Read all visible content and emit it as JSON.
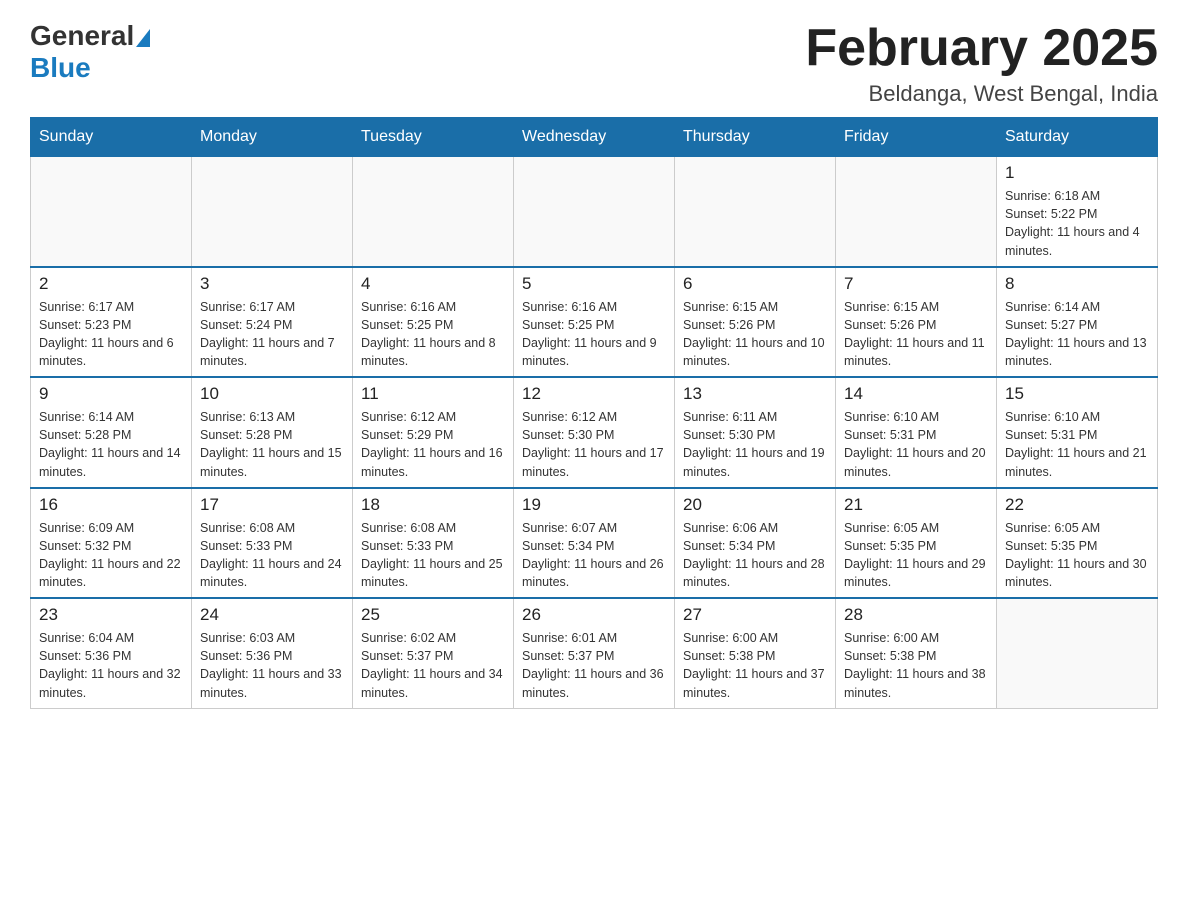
{
  "header": {
    "logo": {
      "general": "General",
      "blue": "Blue"
    },
    "title": "February 2025",
    "subtitle": "Beldanga, West Bengal, India"
  },
  "days_of_week": [
    "Sunday",
    "Monday",
    "Tuesday",
    "Wednesday",
    "Thursday",
    "Friday",
    "Saturday"
  ],
  "weeks": [
    [
      {
        "day": "",
        "info": ""
      },
      {
        "day": "",
        "info": ""
      },
      {
        "day": "",
        "info": ""
      },
      {
        "day": "",
        "info": ""
      },
      {
        "day": "",
        "info": ""
      },
      {
        "day": "",
        "info": ""
      },
      {
        "day": "1",
        "info": "Sunrise: 6:18 AM\nSunset: 5:22 PM\nDaylight: 11 hours and 4 minutes."
      }
    ],
    [
      {
        "day": "2",
        "info": "Sunrise: 6:17 AM\nSunset: 5:23 PM\nDaylight: 11 hours and 6 minutes."
      },
      {
        "day": "3",
        "info": "Sunrise: 6:17 AM\nSunset: 5:24 PM\nDaylight: 11 hours and 7 minutes."
      },
      {
        "day": "4",
        "info": "Sunrise: 6:16 AM\nSunset: 5:25 PM\nDaylight: 11 hours and 8 minutes."
      },
      {
        "day": "5",
        "info": "Sunrise: 6:16 AM\nSunset: 5:25 PM\nDaylight: 11 hours and 9 minutes."
      },
      {
        "day": "6",
        "info": "Sunrise: 6:15 AM\nSunset: 5:26 PM\nDaylight: 11 hours and 10 minutes."
      },
      {
        "day": "7",
        "info": "Sunrise: 6:15 AM\nSunset: 5:26 PM\nDaylight: 11 hours and 11 minutes."
      },
      {
        "day": "8",
        "info": "Sunrise: 6:14 AM\nSunset: 5:27 PM\nDaylight: 11 hours and 13 minutes."
      }
    ],
    [
      {
        "day": "9",
        "info": "Sunrise: 6:14 AM\nSunset: 5:28 PM\nDaylight: 11 hours and 14 minutes."
      },
      {
        "day": "10",
        "info": "Sunrise: 6:13 AM\nSunset: 5:28 PM\nDaylight: 11 hours and 15 minutes."
      },
      {
        "day": "11",
        "info": "Sunrise: 6:12 AM\nSunset: 5:29 PM\nDaylight: 11 hours and 16 minutes."
      },
      {
        "day": "12",
        "info": "Sunrise: 6:12 AM\nSunset: 5:30 PM\nDaylight: 11 hours and 17 minutes."
      },
      {
        "day": "13",
        "info": "Sunrise: 6:11 AM\nSunset: 5:30 PM\nDaylight: 11 hours and 19 minutes."
      },
      {
        "day": "14",
        "info": "Sunrise: 6:10 AM\nSunset: 5:31 PM\nDaylight: 11 hours and 20 minutes."
      },
      {
        "day": "15",
        "info": "Sunrise: 6:10 AM\nSunset: 5:31 PM\nDaylight: 11 hours and 21 minutes."
      }
    ],
    [
      {
        "day": "16",
        "info": "Sunrise: 6:09 AM\nSunset: 5:32 PM\nDaylight: 11 hours and 22 minutes."
      },
      {
        "day": "17",
        "info": "Sunrise: 6:08 AM\nSunset: 5:33 PM\nDaylight: 11 hours and 24 minutes."
      },
      {
        "day": "18",
        "info": "Sunrise: 6:08 AM\nSunset: 5:33 PM\nDaylight: 11 hours and 25 minutes."
      },
      {
        "day": "19",
        "info": "Sunrise: 6:07 AM\nSunset: 5:34 PM\nDaylight: 11 hours and 26 minutes."
      },
      {
        "day": "20",
        "info": "Sunrise: 6:06 AM\nSunset: 5:34 PM\nDaylight: 11 hours and 28 minutes."
      },
      {
        "day": "21",
        "info": "Sunrise: 6:05 AM\nSunset: 5:35 PM\nDaylight: 11 hours and 29 minutes."
      },
      {
        "day": "22",
        "info": "Sunrise: 6:05 AM\nSunset: 5:35 PM\nDaylight: 11 hours and 30 minutes."
      }
    ],
    [
      {
        "day": "23",
        "info": "Sunrise: 6:04 AM\nSunset: 5:36 PM\nDaylight: 11 hours and 32 minutes."
      },
      {
        "day": "24",
        "info": "Sunrise: 6:03 AM\nSunset: 5:36 PM\nDaylight: 11 hours and 33 minutes."
      },
      {
        "day": "25",
        "info": "Sunrise: 6:02 AM\nSunset: 5:37 PM\nDaylight: 11 hours and 34 minutes."
      },
      {
        "day": "26",
        "info": "Sunrise: 6:01 AM\nSunset: 5:37 PM\nDaylight: 11 hours and 36 minutes."
      },
      {
        "day": "27",
        "info": "Sunrise: 6:00 AM\nSunset: 5:38 PM\nDaylight: 11 hours and 37 minutes."
      },
      {
        "day": "28",
        "info": "Sunrise: 6:00 AM\nSunset: 5:38 PM\nDaylight: 11 hours and 38 minutes."
      },
      {
        "day": "",
        "info": ""
      }
    ]
  ]
}
